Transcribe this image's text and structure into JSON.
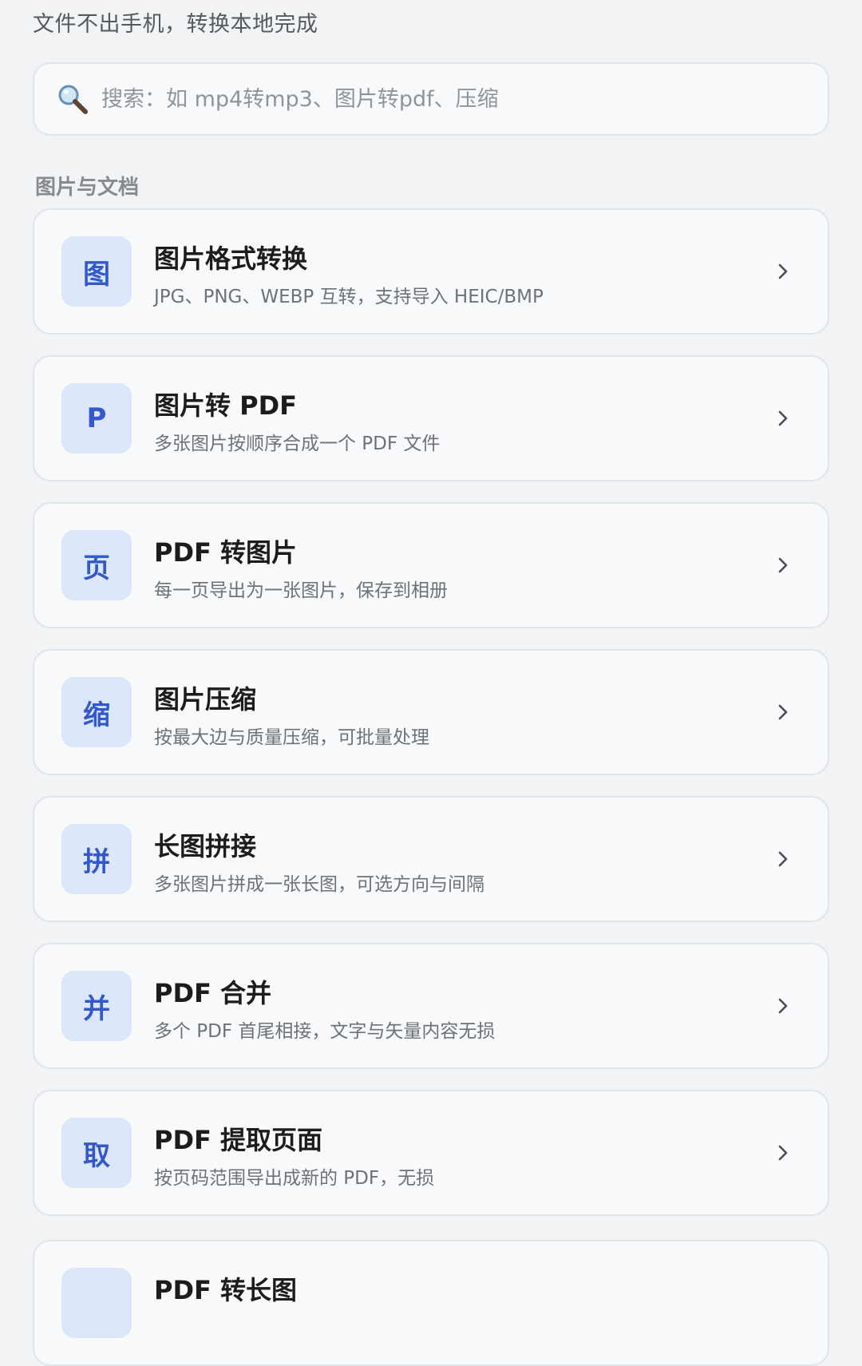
{
  "tagline": "文件不出手机，转换本地完成",
  "search": {
    "placeholder": "搜索：如 mp4转mp3、图片转pdf、压缩",
    "icon": "search-icon"
  },
  "section": {
    "title": "图片与文档"
  },
  "colors": {
    "background": "#f1f3f5",
    "card": "#f8f9fa",
    "badge_bg": "#dce7fb",
    "badge_fg": "#3358c9"
  },
  "tools": [
    {
      "badge": "图",
      "title": "图片格式转换",
      "desc": "JPG、PNG、WEBP 互转，支持导入 HEIC/BMP"
    },
    {
      "badge": "P",
      "title": "图片转 PDF",
      "desc": "多张图片按顺序合成一个 PDF 文件"
    },
    {
      "badge": "页",
      "title": "PDF 转图片",
      "desc": "每一页导出为一张图片，保存到相册"
    },
    {
      "badge": "缩",
      "title": "图片压缩",
      "desc": "按最大边与质量压缩，可批量处理"
    },
    {
      "badge": "拼",
      "title": "长图拼接",
      "desc": "多张图片拼成一张长图，可选方向与间隔"
    },
    {
      "badge": "并",
      "title": "PDF 合并",
      "desc": "多个 PDF 首尾相接，文字与矢量内容无损"
    },
    {
      "badge": "取",
      "title": "PDF 提取页面",
      "desc": "按页码范围导出成新的 PDF，无损"
    },
    {
      "badge": "",
      "title": "PDF 转长图",
      "desc": ""
    }
  ]
}
